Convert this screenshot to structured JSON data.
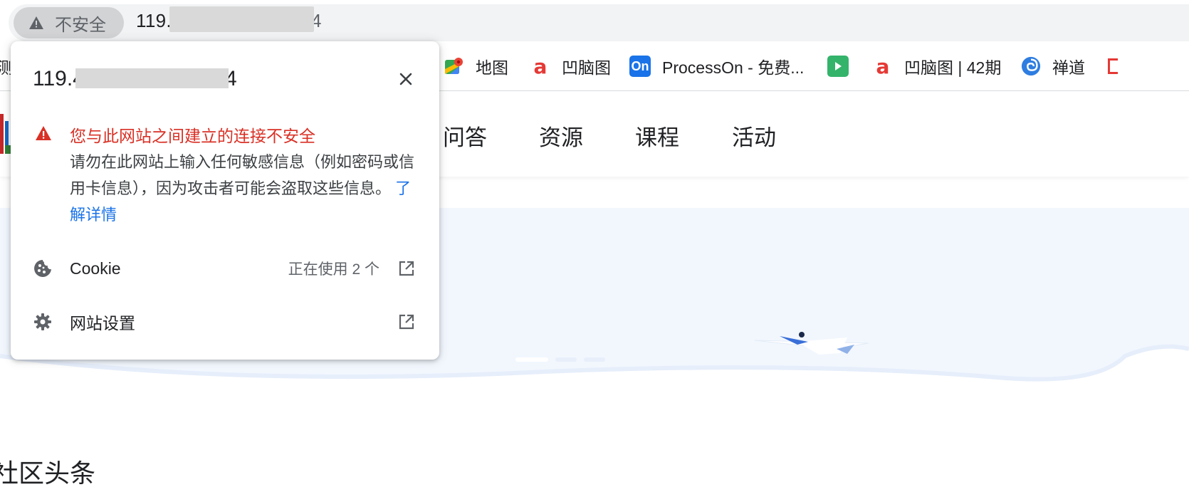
{
  "address_bar": {
    "security_label": "不安全",
    "url_prefix": "119.",
    "url_suffix": "4"
  },
  "bookmarks": [
    {
      "label": "地图",
      "icon": "google-maps-icon"
    },
    {
      "label": "凹脑图",
      "icon": "aonaotu-icon"
    },
    {
      "label": "ProcessOn - 免费...",
      "icon": "processon-icon",
      "icon_text": "On"
    },
    {
      "label": "",
      "icon": "play-icon"
    },
    {
      "label": "凹脑图 | 42期",
      "icon": "aonaotu-icon"
    },
    {
      "label": "禅道",
      "icon": "zentao-icon"
    }
  ],
  "bookmark_partial_left": "测",
  "site_nav": {
    "items": [
      "问答",
      "资源",
      "课程",
      "活动"
    ]
  },
  "section_title": "社区头条",
  "popup": {
    "host_prefix": "119.4",
    "host_suffix": "4",
    "warning_title": "您与此网站之间建立的连接不安全",
    "warning_body": "请勿在此网站上输入任何敏感信息（例如密码或信用卡信息），因为攻击者可能会盗取这些信息。",
    "learn_more": "了解详情",
    "cookie_label": "Cookie",
    "cookie_value": "正在使用 2 个",
    "settings_label": "网站设置"
  },
  "colors": {
    "danger": "#d93025",
    "link": "#1a73e8",
    "hero_bg": "#f2f7fe",
    "chip_bg": "#d2d3d5"
  }
}
